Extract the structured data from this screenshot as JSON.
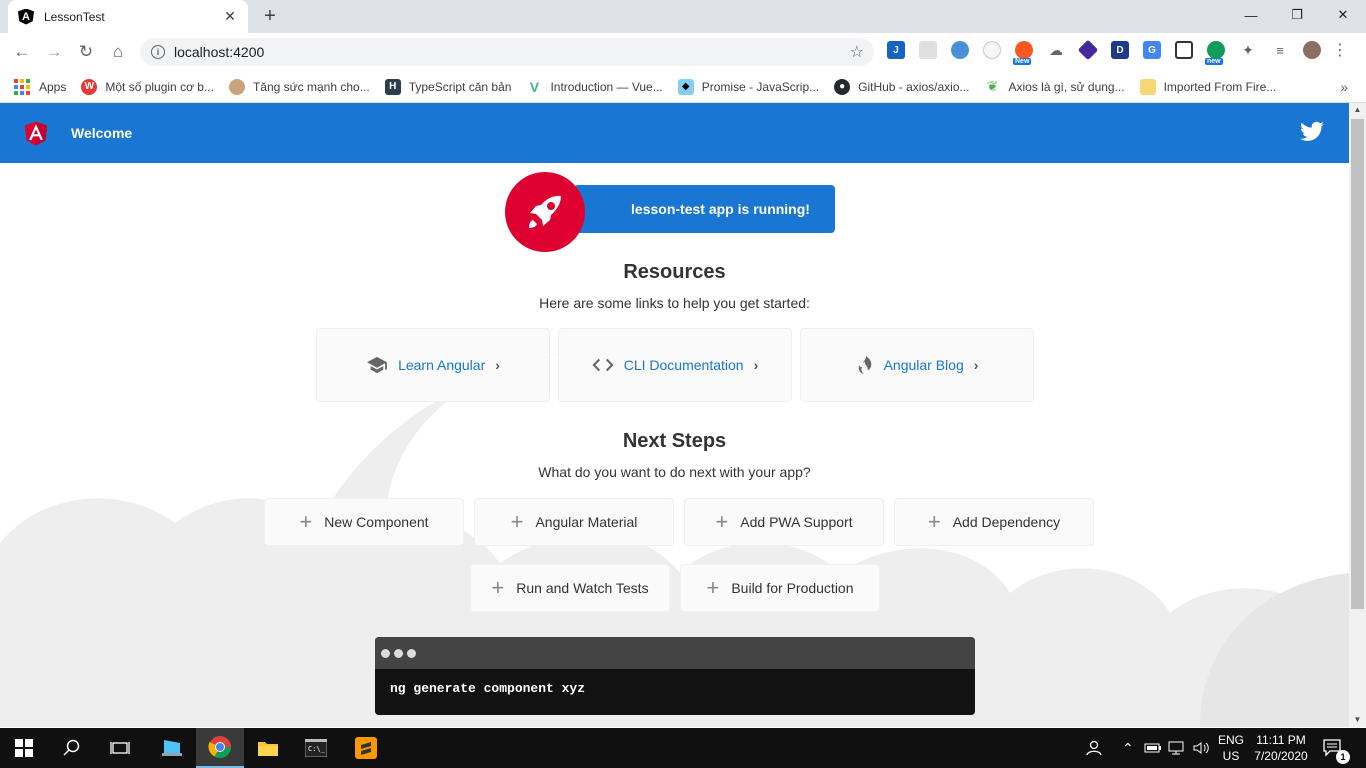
{
  "browser": {
    "tab_title": "LessonTest",
    "url": "localhost:4200",
    "window_controls": [
      "minimize-icon",
      "restore-icon",
      "close-icon"
    ],
    "extensions": [
      "J",
      "D",
      "New",
      "new"
    ]
  },
  "bookmarks": {
    "apps_label": "Apps",
    "items": [
      {
        "label": "Một số plugin cơ b...",
        "icon": "plugin-icon",
        "color": "#e53935"
      },
      {
        "label": "Tăng sức mạnh cho...",
        "icon": "avatar-icon",
        "color": "#c9a27e"
      },
      {
        "label": "TypeScript căn bản",
        "icon": "h-icon",
        "color": "#2c3e50"
      },
      {
        "label": "Introduction — Vue...",
        "icon": "vue-icon",
        "color": "#41b883"
      },
      {
        "label": "Promise - JavaScrip...",
        "icon": "mdn-icon",
        "color": "#83d0f2"
      },
      {
        "label": "GitHub - axios/axio...",
        "icon": "github-icon",
        "color": "#24292e"
      },
      {
        "label": "Axios là gì, sử dụng...",
        "icon": "leaf-icon",
        "color": "#4caf50"
      },
      {
        "label": "Imported From Fire...",
        "icon": "folder-icon",
        "color": "#f8d775"
      }
    ]
  },
  "app": {
    "toolbar_title": "Welcome",
    "running_text": "lesson-test app is running!",
    "resources_title": "Resources",
    "resources_subtitle": "Here are some links to help you get started:",
    "resources": [
      {
        "label": "Learn Angular",
        "icon": "graduation-cap-icon"
      },
      {
        "label": "CLI Documentation",
        "icon": "code-brackets-icon"
      },
      {
        "label": "Angular Blog",
        "icon": "flame-icon"
      }
    ],
    "next_steps_title": "Next Steps",
    "next_steps_subtitle": "What do you want to do next with your app?",
    "steps": [
      {
        "label": "New Component"
      },
      {
        "label": "Angular Material"
      },
      {
        "label": "Add PWA Support"
      },
      {
        "label": "Add Dependency"
      },
      {
        "label": "Run and Watch Tests"
      },
      {
        "label": "Build for Production"
      }
    ],
    "terminal_command": "ng generate component xyz",
    "colors": {
      "primary": "#1976d2",
      "angular_red": "#dd0031"
    }
  },
  "taskbar": {
    "language": "ENG",
    "region": "US",
    "time": "11:11 PM",
    "date": "7/20/2020",
    "notification_count": "1"
  }
}
